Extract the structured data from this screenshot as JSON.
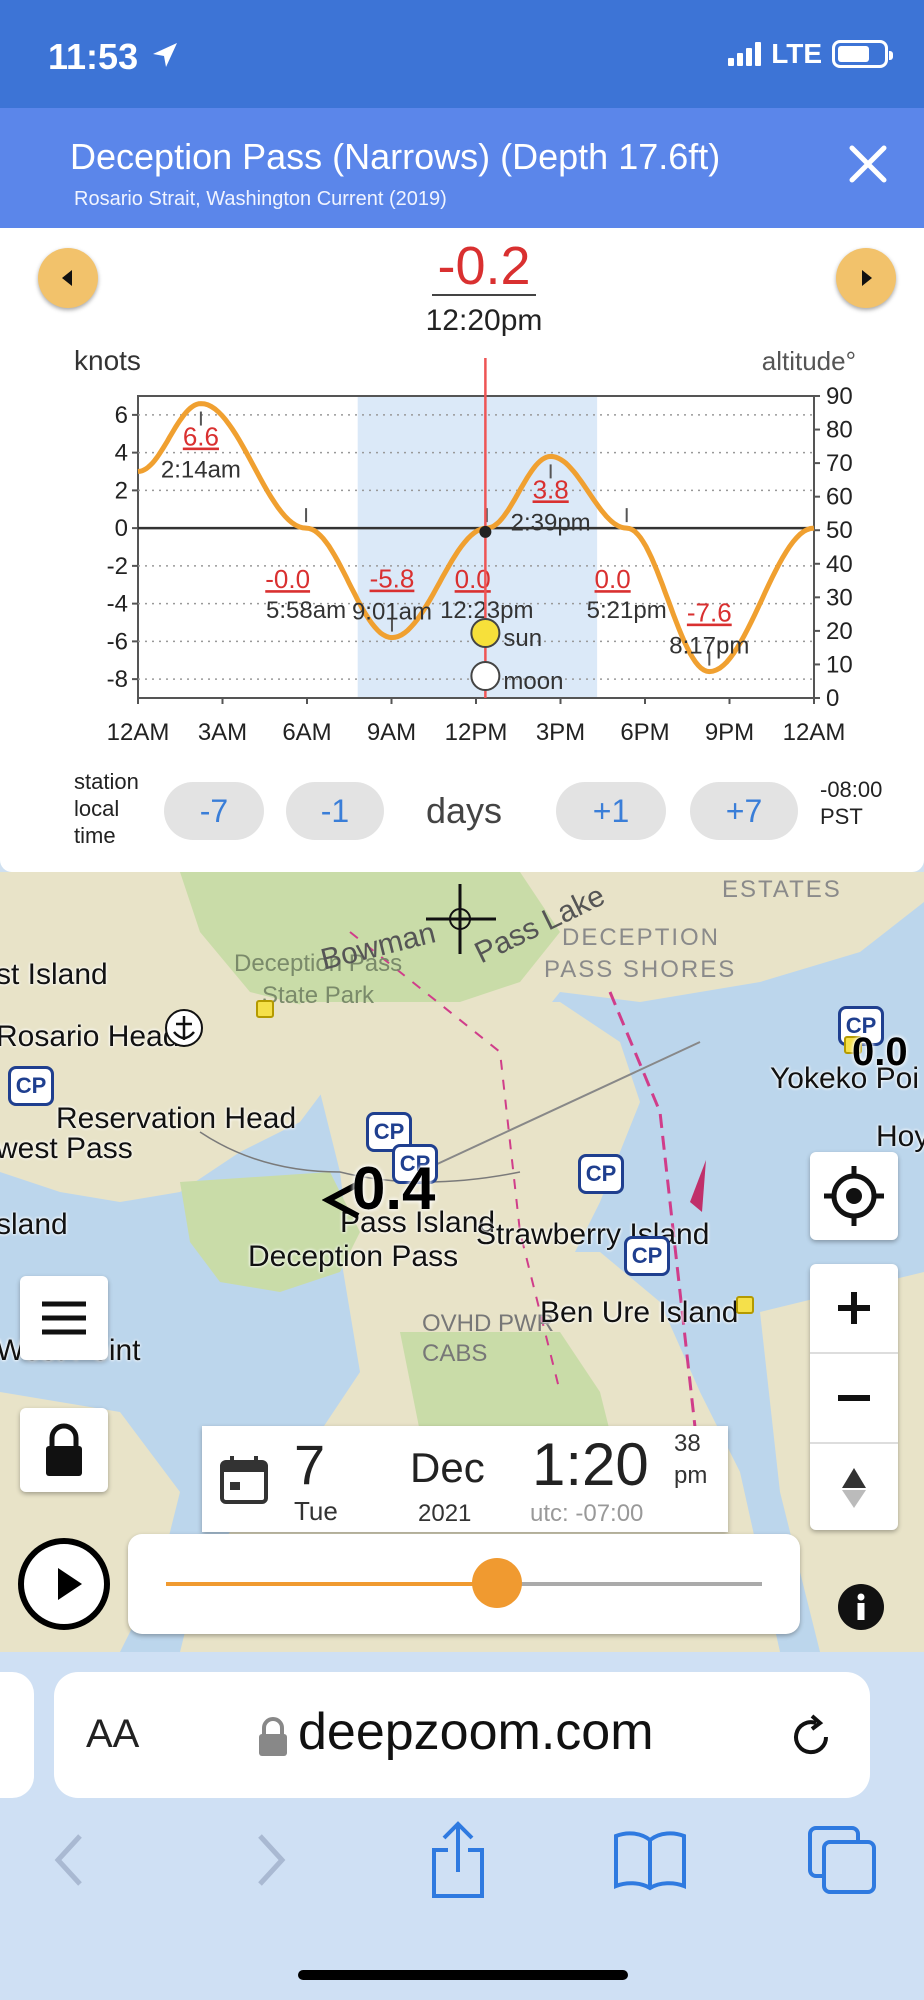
{
  "status": {
    "time": "11:53",
    "network": "LTE"
  },
  "header": {
    "title": "Deception Pass (Narrows) (Depth 17.6ft)",
    "subtitle": "Rosario Strait, Washington Current (2019)"
  },
  "readout": {
    "value": "-0.2",
    "time": "12:20pm"
  },
  "chart_data": {
    "type": "line",
    "ylabel": "knots",
    "ylabel_right": "altitude°",
    "ylim": [
      -9,
      7
    ],
    "yticks": [
      "6",
      "4",
      "2",
      "0",
      "-2",
      "-4",
      "-6",
      "-8"
    ],
    "yticks_right": [
      "90",
      "80",
      "70",
      "60",
      "50",
      "40",
      "30",
      "20",
      "10",
      "0"
    ],
    "xlim": [
      0,
      24
    ],
    "xticks": [
      "12AM",
      "3AM",
      "6AM",
      "9AM",
      "12PM",
      "3PM",
      "6PM",
      "9PM",
      "12AM"
    ],
    "series": [
      {
        "x": [
          0,
          2.233,
          5.967,
          9.017,
          12.383,
          14.65,
          17.35,
          20.283,
          24
        ],
        "y": [
          3.0,
          6.6,
          0.0,
          -5.8,
          0.0,
          3.8,
          0.0,
          -7.6,
          0.0
        ]
      }
    ],
    "annotations": [
      {
        "x": 2.233,
        "value": "6.6",
        "time": "2:14am"
      },
      {
        "x": 5.967,
        "value": "-0.0",
        "time": "5:58am"
      },
      {
        "x": 9.017,
        "value": "-5.8",
        "time": "9:01am"
      },
      {
        "x": 12.383,
        "value": "0.0",
        "time": "12:23pm"
      },
      {
        "x": 14.65,
        "value": "3.8",
        "time": "2:39pm"
      },
      {
        "x": 17.35,
        "value": "0.0",
        "time": "5:21pm"
      },
      {
        "x": 20.283,
        "value": "-7.6",
        "time": "8:17pm"
      }
    ],
    "daylight": [
      7.8,
      16.3
    ],
    "cursor_x": 12.333,
    "sun_label": "sun",
    "moon_label": "moon",
    "grid": true
  },
  "days": {
    "station_label": [
      "station",
      "local",
      "time"
    ],
    "buttons": [
      "-7",
      "-1",
      "+1",
      "+7"
    ],
    "label": "days",
    "tz": [
      "-08:00",
      "PST"
    ]
  },
  "map": {
    "labels": [
      "st Island",
      "Rosario Head",
      "Reservation Head",
      "west Pass",
      "sland",
      "Deception Pass",
      "Pass Island",
      "Strawberry Island",
      "Ben Ure Island",
      "Yokeko Poi",
      "Hoy",
      "West Point"
    ],
    "faint_labels": [
      "ESTATES",
      "DECEPTION",
      "PASS SHORES",
      "Deception Pass",
      "State Park",
      "Bowman",
      "Pass Lake",
      "OVHD PWR",
      "CABS"
    ],
    "currents": [
      "0.0",
      "0.4"
    ],
    "cp_label": "CP"
  },
  "date": {
    "day": "7",
    "weekday": "Tue",
    "month": "Dec",
    "year": "2021",
    "time": "1:20",
    "seconds": "38",
    "ampm": "pm",
    "utc": "utc: -07:00"
  },
  "slider": {
    "fraction": 0.555
  },
  "browser": {
    "aa": "AA",
    "url": "deepzoom.com"
  }
}
